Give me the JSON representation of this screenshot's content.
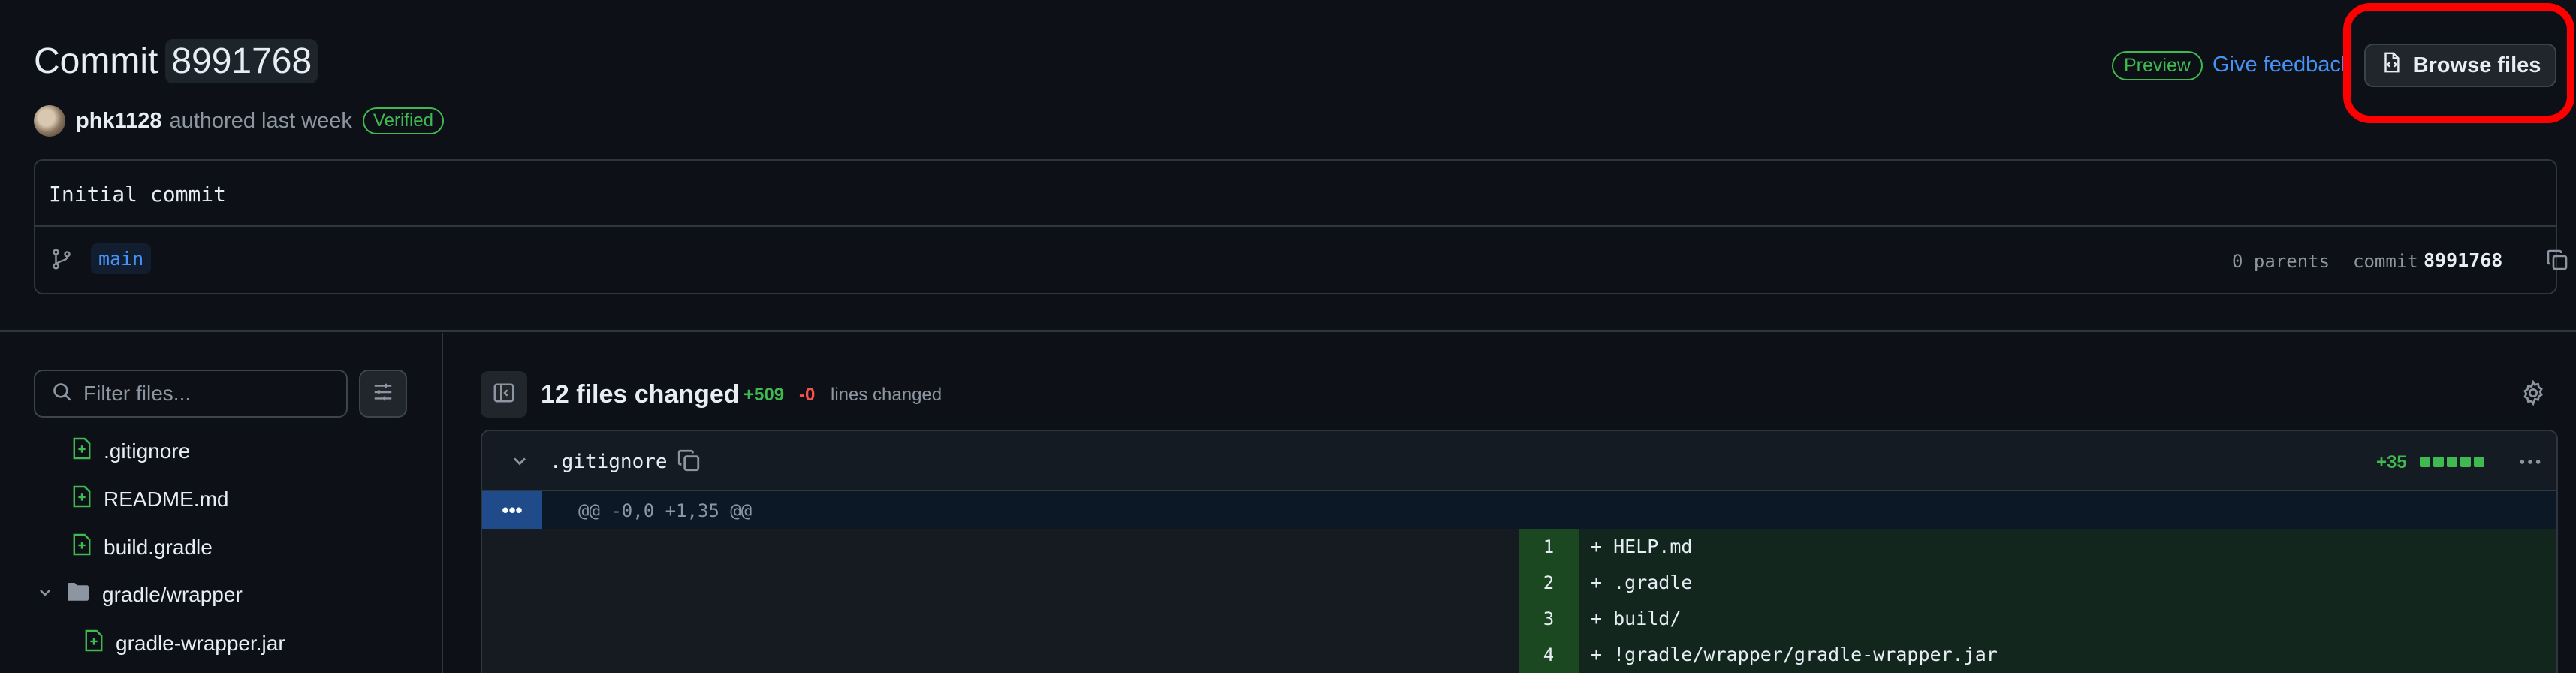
{
  "header": {
    "title_prefix": "Commit",
    "sha": "8991768",
    "author": "phk1128",
    "authored_text": "authored last week",
    "verified_label": "Verified",
    "preview_label": "Preview",
    "feedback_label": "Give feedback",
    "browse_label": "Browse files"
  },
  "commit": {
    "message": "Initial commit",
    "branch": "main",
    "parents": "0 parents",
    "commit_label": "commit",
    "commit_sha": "8991768"
  },
  "filetree": {
    "filter_placeholder": "Filter files...",
    "items": [
      {
        "label": ".gitignore",
        "type": "file-added"
      },
      {
        "label": "README.md",
        "type": "file-added"
      },
      {
        "label": "build.gradle",
        "type": "file-added"
      },
      {
        "label": "gradle/wrapper",
        "type": "folder"
      },
      {
        "label": "gradle-wrapper.jar",
        "type": "file-added"
      }
    ]
  },
  "diff": {
    "files_changed": "12 files changed",
    "additions": "+509",
    "deletions": "-0",
    "lines_changed_label": "lines changed",
    "file": {
      "name": ".gitignore",
      "count": "+35",
      "hunk_expand": "•••",
      "hunk_header": "@@ -0,0 +1,35 @@",
      "lines": [
        {
          "num": "1",
          "text": "+ HELP.md"
        },
        {
          "num": "2",
          "text": "+ .gradle"
        },
        {
          "num": "3",
          "text": "+ build/"
        },
        {
          "num": "4",
          "text": "+ !gradle/wrapper/gradle-wrapper.jar"
        }
      ]
    }
  },
  "colors": {
    "background": "#0d1117",
    "accent_blue": "#4493f8",
    "addition_green": "#3fb950",
    "deletion_red": "#f85149",
    "highlight_red": "#ff0000"
  },
  "icons": [
    "avatar",
    "file-code-icon",
    "branch-icon",
    "copy-icon",
    "search-icon",
    "sliders-icon",
    "file-added-icon",
    "folder-icon",
    "chevron-down-icon",
    "sidebar-toggle-icon",
    "gear-icon",
    "kebab-icon"
  ]
}
